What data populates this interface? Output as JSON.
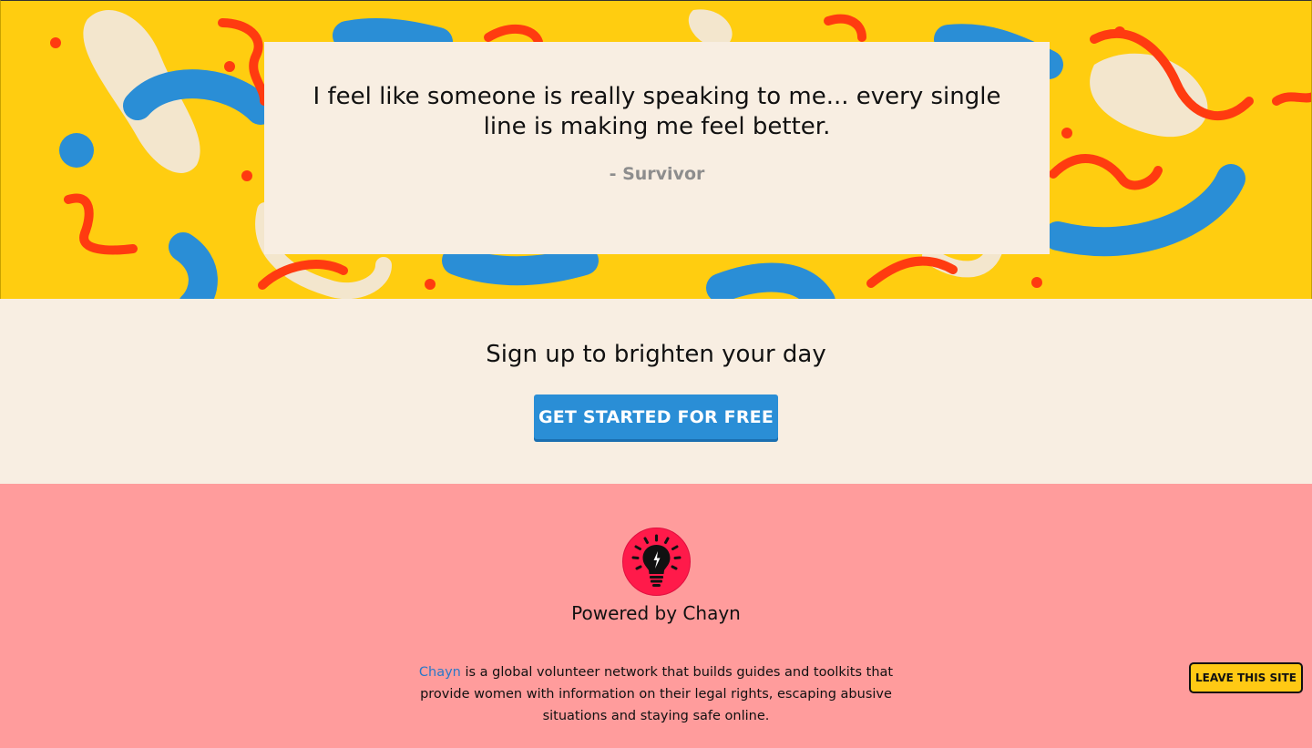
{
  "hero": {
    "quote": "I feel like someone is really speaking to me... every single line is making me feel better.",
    "author": "- Survivor",
    "colors": {
      "background": "#ffcd10",
      "blue": "#2a8ed6",
      "red": "#ff3b10",
      "cream": "#f3e6cd"
    }
  },
  "signup": {
    "heading": "Sign up to brighten your day",
    "cta_label": "GET STARTED FOR FREE"
  },
  "footer": {
    "logo_icon": "lightbulb-icon",
    "powered_by": "Powered by Chayn",
    "about_link": "Chayn",
    "about_text": " is a global volunteer network that builds guides and toolkits that provide women with information on their legal rights, escaping abusive situations and staying safe online.",
    "background": "#ff9c9c"
  },
  "leave_button": {
    "label": "LEAVE THIS SITE",
    "color": "#ffc914"
  }
}
